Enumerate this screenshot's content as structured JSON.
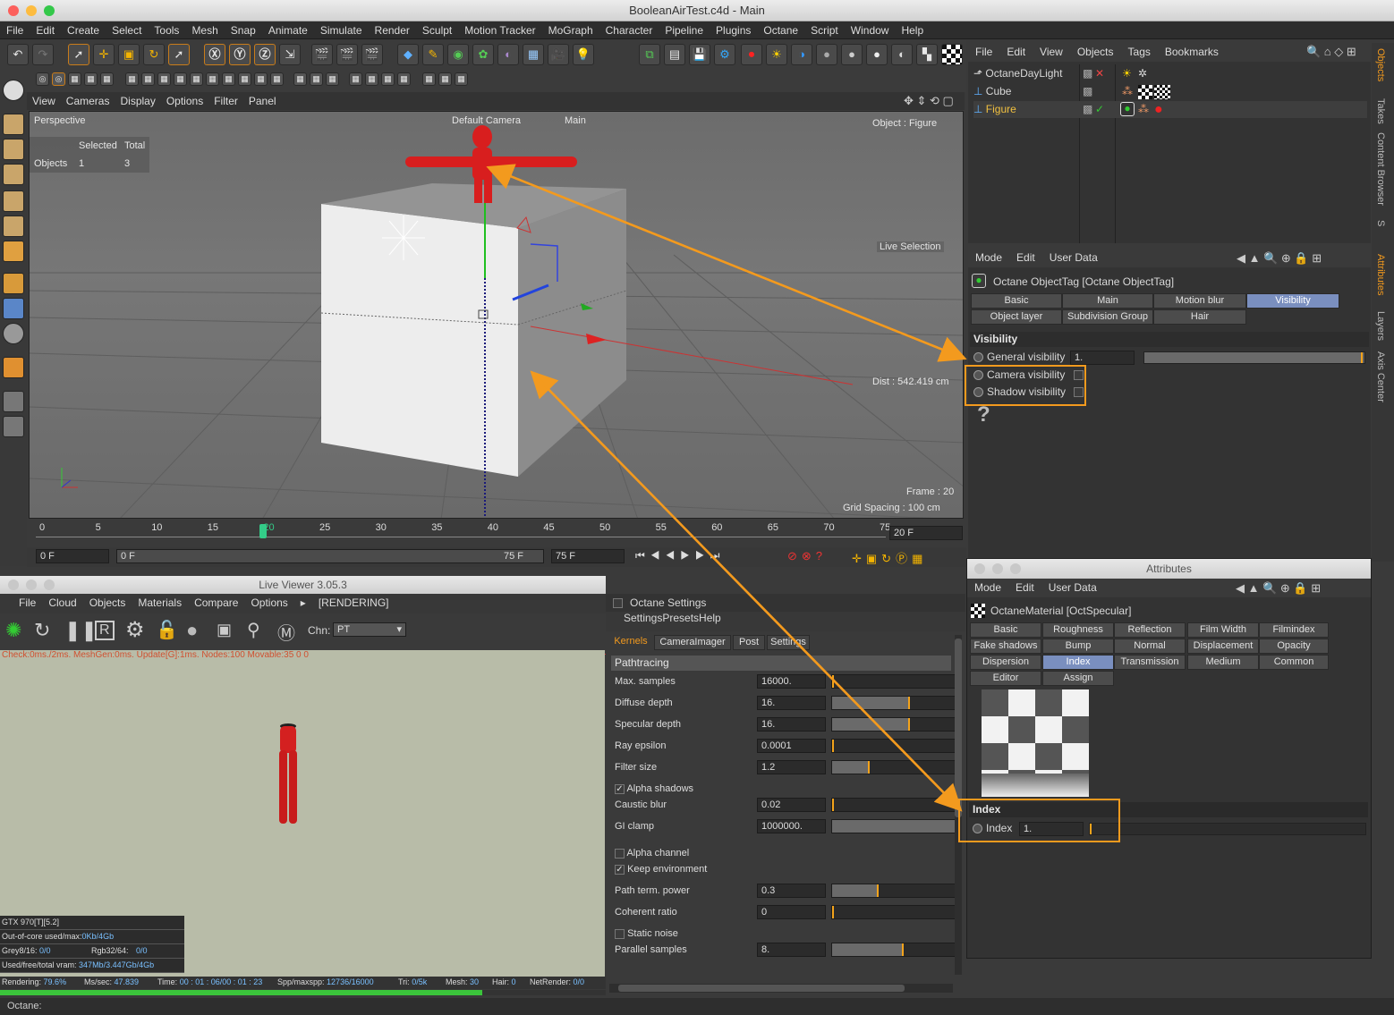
{
  "window": {
    "title": "BooleanAirTest.c4d - Main"
  },
  "menubar": [
    "File",
    "Edit",
    "Create",
    "Select",
    "Tools",
    "Mesh",
    "Snap",
    "Animate",
    "Simulate",
    "Render",
    "Sculpt",
    "Motion Tracker",
    "MoGraph",
    "Character",
    "Pipeline",
    "Plugins",
    "Octane",
    "Script",
    "Window",
    "Help"
  ],
  "viewport": {
    "menu": [
      "View",
      "Cameras",
      "Display",
      "Options",
      "Filter",
      "Panel"
    ],
    "label": "Perspective",
    "camera": "Default Camera",
    "main": "Main",
    "object_info": "Object : Figure",
    "stats_header_selected": "Selected",
    "stats_header_total": "Total",
    "stats_label": "Objects",
    "stats_selected": "1",
    "stats_total": "3",
    "live_selection": "Live Selection",
    "dist": "Dist : 542.419 cm",
    "frame": "Frame : 20",
    "grid_spacing": "Grid Spacing : 100 cm"
  },
  "timeline": {
    "ticks": [
      "0",
      "5",
      "10",
      "15",
      "20",
      "25",
      "30",
      "35",
      "40",
      "45",
      "50",
      "55",
      "60",
      "65",
      "70",
      "75"
    ],
    "current": "20",
    "frame_field": "20 F",
    "start": "0 F",
    "range_start": "0 F",
    "range_end": "75 F",
    "end": "75 F"
  },
  "objects": {
    "menu": [
      "File",
      "Edit",
      "View",
      "Objects",
      "Tags",
      "Bookmarks"
    ],
    "items": [
      {
        "name": "OctaneDayLight"
      },
      {
        "name": "Cube"
      },
      {
        "name": "Figure"
      }
    ]
  },
  "side_tabs": [
    "Objects",
    "Takes",
    "Content Browser",
    "S",
    "Attributes",
    "Layers",
    "Axis Center"
  ],
  "attributes_top": {
    "menu": [
      "Mode",
      "Edit",
      "User Data"
    ],
    "title": "Octane ObjectTag [Octane ObjectTag]",
    "tabs": [
      "Basic",
      "Main",
      "Motion blur",
      "Visibility",
      "Object layer",
      "Subdivision Group",
      "Hair"
    ],
    "section": "Visibility",
    "general_label": "General visibility",
    "general_value": "1.",
    "general_fraction": 1,
    "camera_label": "Camera visibility",
    "shadow_label": "Shadow visibility",
    "question": "?"
  },
  "attributes_bottom": {
    "window_title": "Attributes",
    "menu": [
      "Mode",
      "Edit",
      "User Data"
    ],
    "title": "OctaneMaterial [OctSpecular]",
    "tabs": [
      "Basic",
      "Roughness",
      "Reflection",
      "Film Width",
      "Filmindex",
      "Fake shadows",
      "Bump",
      "Normal",
      "Displacement",
      "Opacity",
      "Dispersion",
      "Index",
      "Transmission",
      "Medium",
      "Common",
      "Editor",
      "Assign"
    ],
    "section": "Index",
    "index_label": "Index",
    "index_value": "1."
  },
  "live_viewer": {
    "title": "Live Viewer 3.05.3",
    "menu": [
      "File",
      "Cloud",
      "Objects",
      "Materials",
      "Compare",
      "Options",
      "▸",
      "[RENDERING]"
    ],
    "channel_label": "Chn:",
    "channel_value": "PT",
    "check_line": "Check:0ms./2ms. MeshGen:0ms. Update[G]:1ms. Nodes:100 Movable:35  0  0",
    "gpu": "GTX 970[T][5.2]",
    "out_of_core_label": "Out-of-core used/max:",
    "out_of_core_value": "0Kb/4Gb",
    "grey_label": "Grey8/16:",
    "grey_value": "0/0",
    "rgb_label": "Rgb32/64:",
    "rgb_value": "0/0",
    "vram_label": "Used/free/total vram:",
    "vram_value": "347Mb/3.447Gb/4Gb",
    "status_rendering_label": "Rendering:",
    "status_rendering": "79.6%",
    "status_mssec_label": "Ms/sec:",
    "status_mssec": "47.839",
    "status_time_label": "Time:",
    "status_time": "00 : 01 : 06/00 : 01 : 23",
    "status_spp_label": "Spp/maxspp:",
    "status_spp": "12736/16000",
    "status_tri_label": "Tri:",
    "status_tri": "0/5k",
    "status_mesh_label": "Mesh:",
    "status_mesh": "30",
    "status_hair_label": "Hair:",
    "status_hair": "0",
    "status_netrender_label": "NetRender:",
    "status_netrender": "0/0",
    "progress": 0.796
  },
  "octane_settings": {
    "title": "Octane Settings",
    "menu": [
      "Settings",
      "Presets",
      "Help"
    ],
    "tabs": [
      "Kernels",
      "CameraImager",
      "Post",
      "Settings"
    ],
    "section": "Pathtracing",
    "rows": [
      {
        "label": "Max. samples",
        "value": "16000.",
        "fill": 0
      },
      {
        "label": "Diffuse depth",
        "value": "16.",
        "fill": 0.62
      },
      {
        "label": "Specular depth",
        "value": "16.",
        "fill": 0.62
      },
      {
        "label": "Ray epsilon",
        "value": "0.0001",
        "fill": 0
      },
      {
        "label": "Filter size",
        "value": "1.2",
        "fill": 0.3
      },
      {
        "label": "Caustic blur",
        "value": "0.02",
        "fill": 0.01
      },
      {
        "label": "GI clamp",
        "value": "1000000.",
        "fill": 1
      },
      {
        "label": "Path term. power",
        "value": "0.3",
        "fill": 0.37
      },
      {
        "label": "Coherent ratio",
        "value": "0",
        "fill": 0
      },
      {
        "label": "Parallel samples",
        "value": "8.",
        "fill": 0.57
      }
    ],
    "alpha_shadows": "Alpha shadows",
    "alpha_channel": "Alpha channel",
    "keep_environment": "Keep environment",
    "static_noise": "Static noise"
  },
  "bottom_status": "Octane:",
  "colors": {
    "accent_orange": "#f39a1e",
    "selected_tab": "#7a8fbf",
    "figure_red": "#d81e1e",
    "selected_object": "#f0c040"
  }
}
